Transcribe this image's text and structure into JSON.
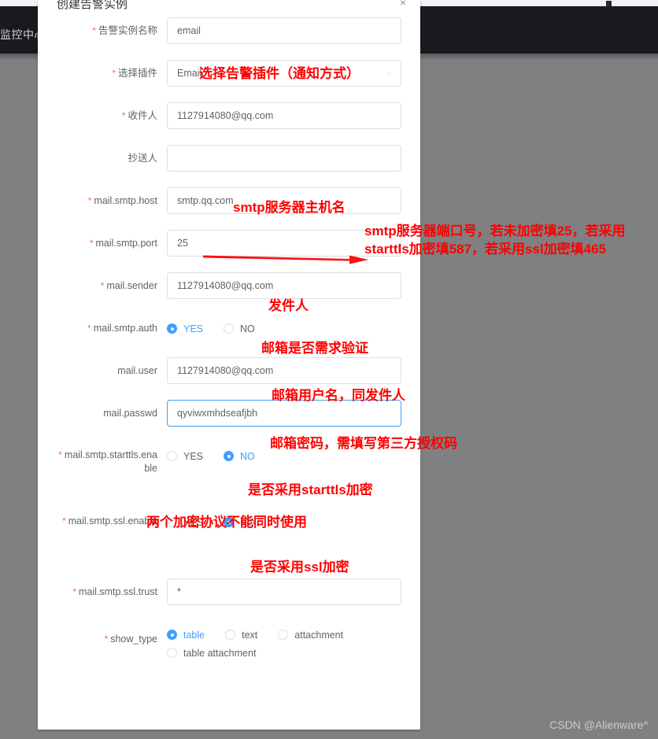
{
  "browser": {
    "dot_icon": "window-dot"
  },
  "navbar": {
    "brand": "监控中心"
  },
  "dialog": {
    "title": "创建告警实例",
    "close_label": "×",
    "fields": [
      {
        "key": "alert-instance-name",
        "label": "告警实例名称",
        "required": true,
        "type": "input",
        "value": "email",
        "placeholder": "",
        "focused": false
      },
      {
        "key": "select-plugin",
        "label": "选择插件",
        "required": true,
        "type": "select",
        "value": "Email",
        "placeholder": "",
        "focused": false
      },
      {
        "key": "receiver",
        "label": "收件人",
        "required": true,
        "type": "input",
        "value": "1127914080@qq.com",
        "placeholder": "",
        "focused": false
      },
      {
        "key": "cc",
        "label": "抄送人",
        "required": false,
        "type": "input",
        "value": "",
        "placeholder": "",
        "focused": false
      },
      {
        "key": "mail-smtp-host",
        "label": "mail.smtp.host",
        "required": true,
        "type": "input",
        "value": "smtp.qq.com",
        "placeholder": "",
        "focused": false
      },
      {
        "key": "mail-smtp-port",
        "label": "mail.smtp.port",
        "required": true,
        "type": "input",
        "value": "25",
        "placeholder": "",
        "focused": false
      },
      {
        "key": "mail-sender",
        "label": "mail.sender",
        "required": true,
        "type": "input",
        "value": "1127914080@qq.com",
        "placeholder": "",
        "focused": false
      },
      {
        "key": "mail-smtp-auth",
        "label": "mail.smtp.auth",
        "required": true,
        "type": "radio",
        "options": [
          "YES",
          "NO"
        ],
        "selected": "YES"
      },
      {
        "key": "mail-user",
        "label": "mail.user",
        "required": false,
        "type": "input",
        "value": "1127914080@qq.com",
        "placeholder": "",
        "focused": false
      },
      {
        "key": "mail-passwd",
        "label": "mail.passwd",
        "required": false,
        "type": "input",
        "value": "qyviwxmhdseafjbh",
        "placeholder": "",
        "focused": true
      },
      {
        "key": "mail-smtp-starttls-enable",
        "label": "mail.smtp.starttls.enable",
        "required": true,
        "type": "radio",
        "options": [
          "YES",
          "NO"
        ],
        "selected": "NO"
      },
      {
        "key": "mail-smtp-ssl-enable",
        "label": "mail.smtp.ssl.enable",
        "required": true,
        "type": "radio",
        "options": [
          "YES",
          "NO"
        ],
        "selected": "NO"
      },
      {
        "key": "mail-smtp-ssl-trust",
        "label": "mail.smtp.ssl.trust",
        "required": true,
        "type": "input",
        "value": "*",
        "placeholder": "",
        "focused": false
      },
      {
        "key": "show-type",
        "label": "show_type",
        "required": true,
        "type": "radio",
        "options": [
          "table",
          "text",
          "attachment",
          "table attachment"
        ],
        "selected": "table"
      }
    ]
  },
  "annotations": {
    "plugin": "选择告警插件（通知方式）",
    "smtp_host": "smtp服务器主机名",
    "smtp_port": "smtp服务器端口号，若未加密填25，若采用starttls加密填587，若采用ssl加密填465",
    "sender": "发件人",
    "smtp_auth": "邮箱是否需求验证",
    "mail_user": "邮箱用户名，同发件人",
    "mail_passwd": "邮箱密码，需填写第三方授权码",
    "starttls": "是否采用starttls加密",
    "both_protocols": "两个加密协议不能同时使用",
    "ssl": "是否采用ssl加密",
    "arrow_icon": "red-arrow-right"
  },
  "watermark": {
    "text": "CSDN @Alienware^"
  },
  "colors": {
    "accent": "#409eff",
    "required": "#f56c6c",
    "annotation": "#ff0000",
    "navbar": "#181a1f",
    "backdrop": "#7f8082"
  }
}
